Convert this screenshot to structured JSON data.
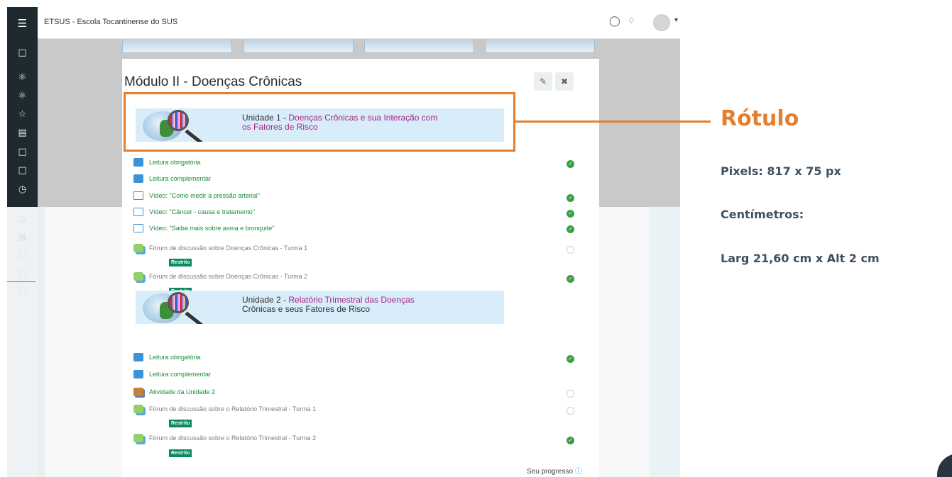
{
  "topbar": {
    "site_name": "ETSUS - Escola Tocantinense do SUS"
  },
  "modal": {
    "title": "Módulo II - Doenças Crônicas"
  },
  "unit1": {
    "prefix": "Unidade  1 - ",
    "title_line1": "Doenças Crônicas e sua Interação com",
    "title_line2": "os Fatores de Risco"
  },
  "unit2": {
    "prefix": "Unidade  2 - ",
    "title_line1": "Relatório Trimestral das Doenças",
    "title_line2": "Crônicas e seus Fatores de Risco"
  },
  "unit1_items": [
    {
      "icon": "folder-icon",
      "label": "Leitura obrigatória",
      "status": "complete"
    },
    {
      "icon": "folder-icon",
      "label": "Leitura complementar",
      "status": "none"
    },
    {
      "icon": "page-icon",
      "label": "Vídeo: \"Como medir a pressão arterial\"",
      "status": "complete"
    },
    {
      "icon": "page-icon",
      "label": "Vídeo: \"Câncer - causa e tratamento\"",
      "status": "complete"
    },
    {
      "icon": "page-icon",
      "label": "Vídeo: \"Saiba mais sobre asma e bronquite\"",
      "status": "complete"
    },
    {
      "icon": "forum-icon",
      "label": "Fórum de discussão sobre Doenças Crônicas - Turma 1",
      "status": "incomplete",
      "badge": "Restrito"
    },
    {
      "icon": "forum-icon",
      "label": "Fórum de discussão sobre Doenças Crônicas - Turma 2",
      "status": "complete",
      "badge": "Restrito"
    }
  ],
  "unit2_items": [
    {
      "icon": "folder-icon",
      "label": "Leitura obrigatória",
      "status": "complete"
    },
    {
      "icon": "folder-icon",
      "label": "Leitura complementar",
      "status": "none"
    },
    {
      "icon": "assignment-icon",
      "label": "Atividade da Unidade 2",
      "status": "incomplete"
    },
    {
      "icon": "forum-icon",
      "label": "Fórum de discussão sobre o Relatório Trimestral - Turma 1",
      "status": "incomplete",
      "badge": "Restrito"
    },
    {
      "icon": "forum-icon",
      "label": "Fórum de discussão sobre o Relatório Trimestral - Turma 2",
      "status": "complete",
      "badge": "Restrito"
    }
  ],
  "progress_label": "Seu progresso",
  "annotation": {
    "title": "Rótulo",
    "pixels": "Pixels: 817 x 75 px",
    "cm_heading": "Centímetros:",
    "cm_value": "Larg 21,60 cm x Alt 2 cm"
  },
  "colors": {
    "accent": "#e57f2e",
    "link_green": "#1a8a3a",
    "unit_title": "#a32683",
    "badge": "#0a8a5f"
  }
}
